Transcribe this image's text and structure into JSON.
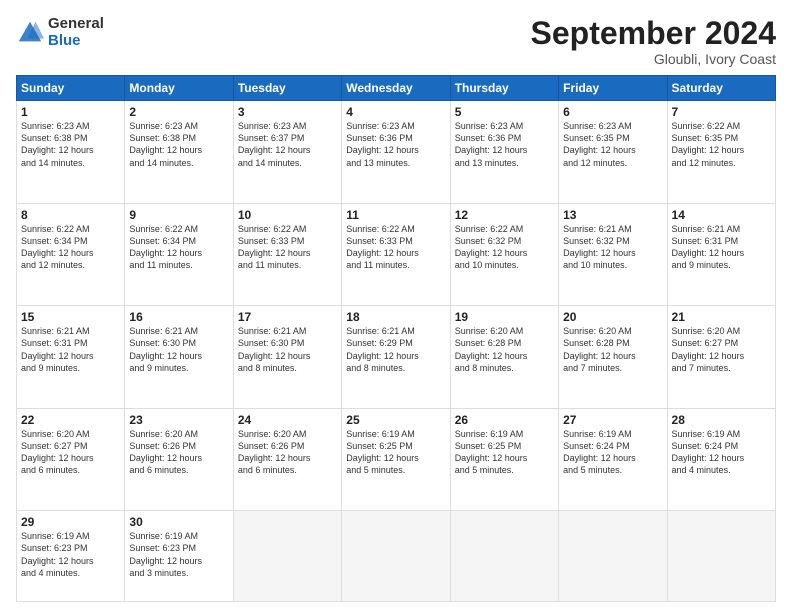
{
  "header": {
    "logo_general": "General",
    "logo_blue": "Blue",
    "month_title": "September 2024",
    "location": "Gloubli, Ivory Coast"
  },
  "days_of_week": [
    "Sunday",
    "Monday",
    "Tuesday",
    "Wednesday",
    "Thursday",
    "Friday",
    "Saturday"
  ],
  "weeks": [
    [
      {
        "num": "1",
        "info": "Sunrise: 6:23 AM\nSunset: 6:38 PM\nDaylight: 12 hours\nand 14 minutes."
      },
      {
        "num": "2",
        "info": "Sunrise: 6:23 AM\nSunset: 6:38 PM\nDaylight: 12 hours\nand 14 minutes."
      },
      {
        "num": "3",
        "info": "Sunrise: 6:23 AM\nSunset: 6:37 PM\nDaylight: 12 hours\nand 14 minutes."
      },
      {
        "num": "4",
        "info": "Sunrise: 6:23 AM\nSunset: 6:36 PM\nDaylight: 12 hours\nand 13 minutes."
      },
      {
        "num": "5",
        "info": "Sunrise: 6:23 AM\nSunset: 6:36 PM\nDaylight: 12 hours\nand 13 minutes."
      },
      {
        "num": "6",
        "info": "Sunrise: 6:23 AM\nSunset: 6:35 PM\nDaylight: 12 hours\nand 12 minutes."
      },
      {
        "num": "7",
        "info": "Sunrise: 6:22 AM\nSunset: 6:35 PM\nDaylight: 12 hours\nand 12 minutes."
      }
    ],
    [
      {
        "num": "8",
        "info": "Sunrise: 6:22 AM\nSunset: 6:34 PM\nDaylight: 12 hours\nand 12 minutes."
      },
      {
        "num": "9",
        "info": "Sunrise: 6:22 AM\nSunset: 6:34 PM\nDaylight: 12 hours\nand 11 minutes."
      },
      {
        "num": "10",
        "info": "Sunrise: 6:22 AM\nSunset: 6:33 PM\nDaylight: 12 hours\nand 11 minutes."
      },
      {
        "num": "11",
        "info": "Sunrise: 6:22 AM\nSunset: 6:33 PM\nDaylight: 12 hours\nand 11 minutes."
      },
      {
        "num": "12",
        "info": "Sunrise: 6:22 AM\nSunset: 6:32 PM\nDaylight: 12 hours\nand 10 minutes."
      },
      {
        "num": "13",
        "info": "Sunrise: 6:21 AM\nSunset: 6:32 PM\nDaylight: 12 hours\nand 10 minutes."
      },
      {
        "num": "14",
        "info": "Sunrise: 6:21 AM\nSunset: 6:31 PM\nDaylight: 12 hours\nand 9 minutes."
      }
    ],
    [
      {
        "num": "15",
        "info": "Sunrise: 6:21 AM\nSunset: 6:31 PM\nDaylight: 12 hours\nand 9 minutes."
      },
      {
        "num": "16",
        "info": "Sunrise: 6:21 AM\nSunset: 6:30 PM\nDaylight: 12 hours\nand 9 minutes."
      },
      {
        "num": "17",
        "info": "Sunrise: 6:21 AM\nSunset: 6:30 PM\nDaylight: 12 hours\nand 8 minutes."
      },
      {
        "num": "18",
        "info": "Sunrise: 6:21 AM\nSunset: 6:29 PM\nDaylight: 12 hours\nand 8 minutes."
      },
      {
        "num": "19",
        "info": "Sunrise: 6:20 AM\nSunset: 6:28 PM\nDaylight: 12 hours\nand 8 minutes."
      },
      {
        "num": "20",
        "info": "Sunrise: 6:20 AM\nSunset: 6:28 PM\nDaylight: 12 hours\nand 7 minutes."
      },
      {
        "num": "21",
        "info": "Sunrise: 6:20 AM\nSunset: 6:27 PM\nDaylight: 12 hours\nand 7 minutes."
      }
    ],
    [
      {
        "num": "22",
        "info": "Sunrise: 6:20 AM\nSunset: 6:27 PM\nDaylight: 12 hours\nand 6 minutes."
      },
      {
        "num": "23",
        "info": "Sunrise: 6:20 AM\nSunset: 6:26 PM\nDaylight: 12 hours\nand 6 minutes."
      },
      {
        "num": "24",
        "info": "Sunrise: 6:20 AM\nSunset: 6:26 PM\nDaylight: 12 hours\nand 6 minutes."
      },
      {
        "num": "25",
        "info": "Sunrise: 6:19 AM\nSunset: 6:25 PM\nDaylight: 12 hours\nand 5 minutes."
      },
      {
        "num": "26",
        "info": "Sunrise: 6:19 AM\nSunset: 6:25 PM\nDaylight: 12 hours\nand 5 minutes."
      },
      {
        "num": "27",
        "info": "Sunrise: 6:19 AM\nSunset: 6:24 PM\nDaylight: 12 hours\nand 5 minutes."
      },
      {
        "num": "28",
        "info": "Sunrise: 6:19 AM\nSunset: 6:24 PM\nDaylight: 12 hours\nand 4 minutes."
      }
    ],
    [
      {
        "num": "29",
        "info": "Sunrise: 6:19 AM\nSunset: 6:23 PM\nDaylight: 12 hours\nand 4 minutes."
      },
      {
        "num": "30",
        "info": "Sunrise: 6:19 AM\nSunset: 6:23 PM\nDaylight: 12 hours\nand 3 minutes."
      },
      {
        "num": "",
        "info": ""
      },
      {
        "num": "",
        "info": ""
      },
      {
        "num": "",
        "info": ""
      },
      {
        "num": "",
        "info": ""
      },
      {
        "num": "",
        "info": ""
      }
    ]
  ]
}
